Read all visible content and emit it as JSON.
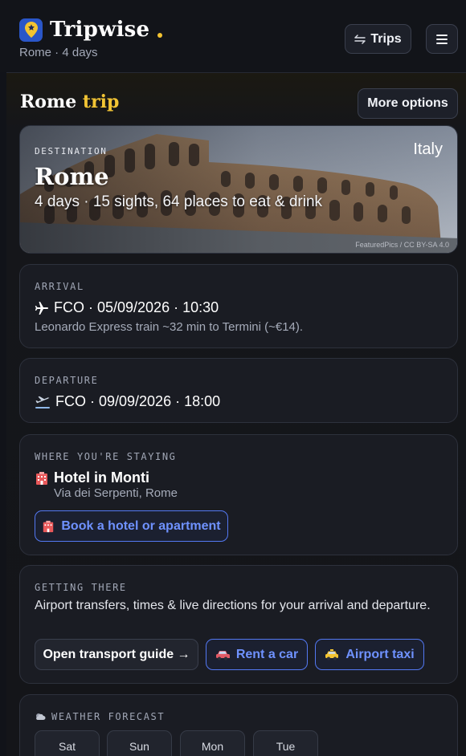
{
  "app": {
    "name": "Tripwise",
    "subtitle": "Rome · 4 days",
    "trips_button": "Trips",
    "accent_color": "#f2c434",
    "brand_color": "#2a56c8"
  },
  "page": {
    "title_city": "Rome",
    "title_word": "trip",
    "more_options": "More options"
  },
  "hero": {
    "eyebrow": "DESTINATION",
    "country": "Italy",
    "city": "Rome",
    "summary": "4 days · 15 sights, 64 places to eat & drink",
    "credit": "FeaturedPics / CC BY-SA 4.0"
  },
  "arrival": {
    "eyebrow": "ARRIVAL",
    "icon": "airplane-icon",
    "line": "FCO · 05/09/2026 · 10:30",
    "note": "Leonardo Express train ~32 min to Termini (~€14)."
  },
  "departure": {
    "eyebrow": "DEPARTURE",
    "icon": "departing-plane-icon",
    "line": "FCO · 09/09/2026 · 18:00"
  },
  "stay": {
    "eyebrow": "WHERE YOU'RE STAYING",
    "icon": "hotel-icon",
    "name": "Hotel in Monti",
    "address": "Via dei Serpenti, Rome",
    "book_button": "Book a hotel or apartment"
  },
  "transport": {
    "eyebrow": "GETTING THERE",
    "description": "Airport transfers, times & live directions for your arrival and departure.",
    "guide_button": "Open transport guide →",
    "rent_button": "Rent a car",
    "taxi_button": "Airport taxi"
  },
  "weather": {
    "eyebrow": "WEATHER FORECAST",
    "icon": "weather-icon",
    "days": [
      "Sat",
      "Sun",
      "Mon",
      "Tue"
    ]
  }
}
